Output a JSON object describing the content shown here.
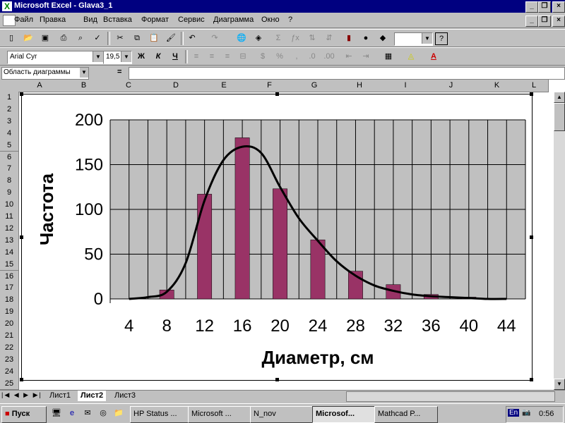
{
  "window": {
    "title": "Microsoft Excel - Glava3_1",
    "app_icon": "excel-icon"
  },
  "menu": [
    "Файл",
    "Правка",
    "Вид",
    "Вставка",
    "Формат",
    "Сервис",
    "Диаграмма",
    "Окно",
    "?"
  ],
  "format_bar": {
    "font": "Arial Cyr",
    "size": "19,5",
    "bold": "Ж",
    "italic": "К",
    "underline": "Ч"
  },
  "formula_bar": {
    "name_box": "Область диаграммы",
    "equals": "=",
    "value": ""
  },
  "columns": [
    "A",
    "B",
    "C",
    "D",
    "E",
    "F",
    "G",
    "H",
    "I",
    "J",
    "K",
    "L"
  ],
  "rows": [
    "1",
    "2",
    "3",
    "4",
    "5",
    "6",
    "7",
    "8",
    "9",
    "10",
    "11",
    "12",
    "13",
    "14",
    "15",
    "16",
    "17",
    "18",
    "19",
    "20",
    "21",
    "22",
    "23",
    "24",
    "25"
  ],
  "sheet_tabs": [
    "Лист1",
    "Лист2",
    "Лист3"
  ],
  "active_sheet": "Лист2",
  "taskbar": {
    "start": "Пуск",
    "buttons": [
      "HP Status ...",
      "Microsoft ...",
      "N_nov",
      "Microsof...",
      "Mathcad P..."
    ],
    "active": "Microsof...",
    "lang": "En",
    "clock": "0:56"
  },
  "colors": {
    "titlebar": "#000080",
    "bar": "#993366",
    "plot_bg": "#c0c0c0"
  },
  "chart_data": {
    "type": "bar",
    "categories": [
      "4",
      "8",
      "12",
      "16",
      "20",
      "24",
      "28",
      "32",
      "36",
      "40",
      "44"
    ],
    "values": [
      0,
      10,
      117,
      180,
      123,
      66,
      31,
      16,
      5,
      2,
      0
    ],
    "series": [
      {
        "type": "bar",
        "values": [
          0,
          10,
          117,
          180,
          123,
          66,
          31,
          16,
          5,
          2,
          0
        ]
      },
      {
        "type": "line",
        "x": [
          4,
          6,
          8,
          10,
          12,
          14,
          16,
          18,
          20,
          22,
          24,
          26,
          28,
          30,
          32,
          34,
          36,
          38,
          40,
          42,
          44
        ],
        "values": [
          0,
          2,
          8,
          40,
          110,
          155,
          170,
          163,
          125,
          90,
          65,
          42,
          26,
          15,
          9,
          5,
          3,
          2,
          1,
          0,
          0
        ]
      }
    ],
    "title": "",
    "xlabel": "Диаметр, см",
    "ylabel": "Частота",
    "ylim": [
      0,
      200
    ],
    "yticks": [
      "0",
      "50",
      "100",
      "150",
      "200"
    ],
    "grid": true
  }
}
